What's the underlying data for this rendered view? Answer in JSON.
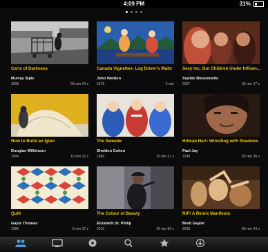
{
  "status_bar": {
    "time": "4:09 PM",
    "battery": "31%"
  },
  "pager": {
    "pages": 4,
    "current": 1
  },
  "films": [
    {
      "title": "Carts of Darkness",
      "author": "Murray Siple",
      "year": "2008",
      "duration": "59 min 34 s"
    },
    {
      "title": "Canada Vignettes: Log Driver's Waltz",
      "author": "John Weldon",
      "year": "1979",
      "duration": "3 min"
    },
    {
      "title": "Sexy Inc. Our Children Under Influen...",
      "author": "Sophie Bissonnette",
      "year": "2007",
      "duration": "35 min 27 s"
    },
    {
      "title": "How to Build an Igloo",
      "author": "Douglas Wilkinson",
      "year": "1949",
      "duration": "10 min 32 s"
    },
    {
      "title": "The Sweater",
      "author": "Sheldon Cohen",
      "year": "1980",
      "duration": "10 min 21 s"
    },
    {
      "title": "Hitman Hart: Wrestling with Shadows",
      "author": "Paul Jay",
      "year": "1998",
      "duration": "93 min 36 s"
    },
    {
      "title": "Quilt",
      "author": "Gayle Thomas",
      "year": "1996",
      "duration": "6 min 37 s"
    },
    {
      "title": "The Colour of Beauty",
      "author": "Elizabeth St. Philip",
      "year": "2010",
      "duration": "16 min 50 s"
    },
    {
      "title": "RiP! A Remix Manifesto",
      "author": "Brett Gaylor",
      "year": "2008",
      "duration": "86 min 24 s"
    }
  ],
  "tabbar": {
    "items": [
      {
        "icon": "people-icon",
        "active": true
      },
      {
        "icon": "tv-icon",
        "active": false
      },
      {
        "icon": "channels-icon",
        "active": false
      },
      {
        "icon": "search-icon",
        "active": false
      },
      {
        "icon": "star-icon",
        "active": false
      },
      {
        "icon": "download-icon",
        "active": false
      }
    ]
  },
  "colors": {
    "accent_title": "#f2c400",
    "tab_active": "#4a9fe8"
  }
}
